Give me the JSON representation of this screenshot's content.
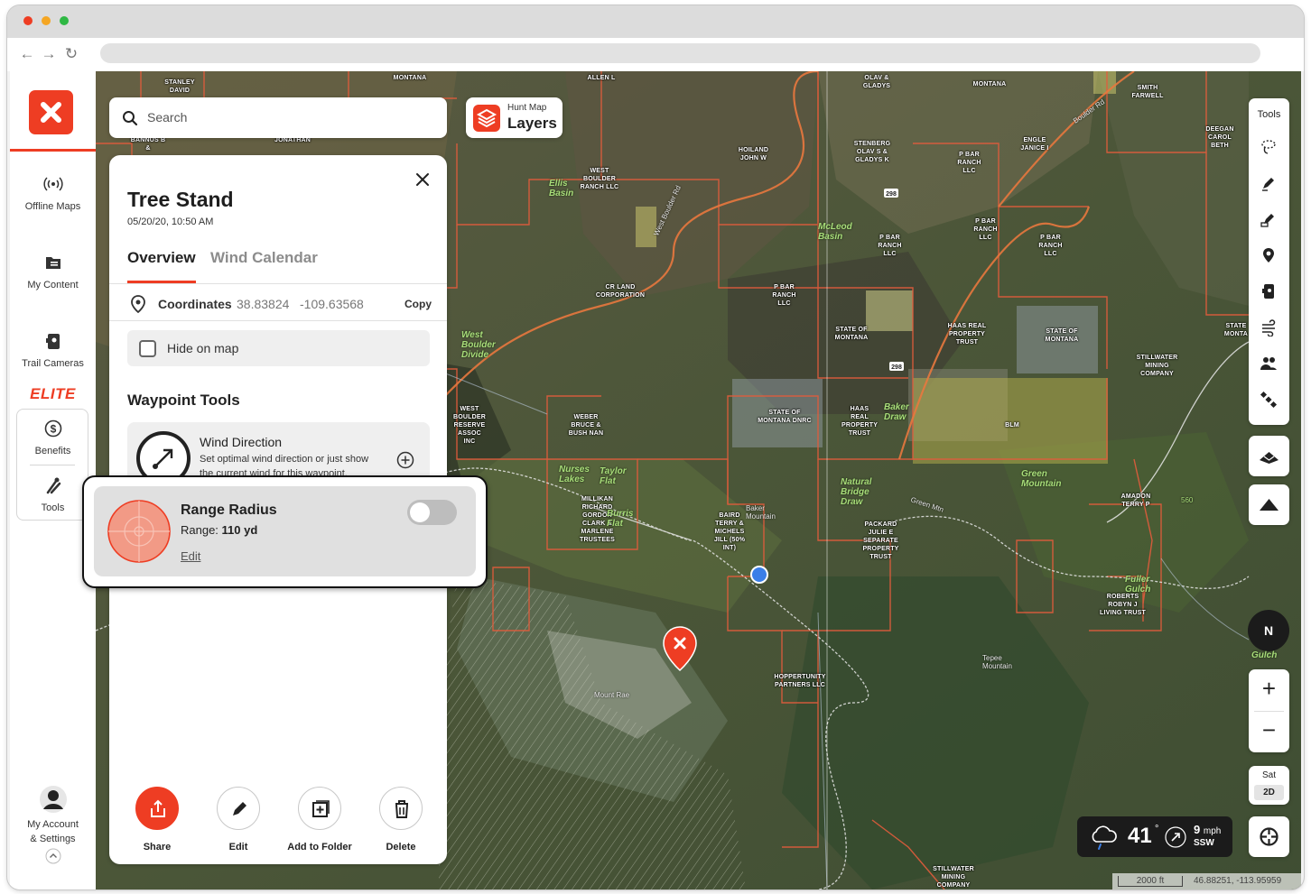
{
  "browser": {
    "dots": [
      "#ee3d23",
      "#f5a623",
      "#2fb844"
    ]
  },
  "sidebar": {
    "items": [
      {
        "label": "Offline Maps",
        "icon": "broadcast-icon"
      },
      {
        "label": "My Content",
        "icon": "folder-icon"
      },
      {
        "label": "Trail Cameras",
        "icon": "camera-icon"
      }
    ],
    "elite": "ELITE",
    "elite_items": [
      {
        "label": "Benefits",
        "icon": "dollar-icon"
      },
      {
        "label": "Tools",
        "icon": "tools-icon"
      }
    ],
    "account": {
      "line1": "My Account",
      "line2": "& Settings"
    }
  },
  "search": {
    "placeholder": "Search"
  },
  "layers": {
    "line1": "Hunt Map",
    "line2": "Layers"
  },
  "panel": {
    "title": "Tree Stand",
    "date": "05/20/20, 10:50 AM",
    "tabs": [
      "Overview",
      "Wind Calendar"
    ],
    "coordinates": {
      "label": "Coordinates",
      "lat": "38.83824",
      "lon": "-109.63568",
      "copy": "Copy"
    },
    "hide_on_map": "Hide on map",
    "waypoint_tools_title": "Waypoint Tools",
    "wind": {
      "title": "Wind Direction",
      "desc": "Set optimal wind direction or just show the current wind for this waypoint."
    },
    "range": {
      "title": "Range Radius",
      "label": "Range:",
      "value": "110 yd",
      "edit": "Edit",
      "enabled": false
    },
    "actions": [
      "Share",
      "Edit",
      "Add to Folder",
      "Delete"
    ]
  },
  "tools": {
    "title": "Tools",
    "icons": [
      "lasso-icon",
      "pencil-icon",
      "marker-icon",
      "pin-icon",
      "camera-icon",
      "wind-icon",
      "people-icon",
      "satellite-icon"
    ]
  },
  "map_controls": {
    "compass": "N",
    "zoom_in": "+",
    "zoom_out": "−",
    "sat": "Sat",
    "mode": "2D"
  },
  "weather": {
    "temp": "41",
    "deg": "°",
    "speed": "9",
    "unit": "mph",
    "dir": "SSW"
  },
  "scale": {
    "distance": "2000 ft",
    "coords": "46.88251, -113.95959"
  },
  "map_labels": {
    "owners": [
      "STANLEY DAVID",
      "MONTANA",
      "ALLEN L",
      "OLAV & GLADYS",
      "MONTANA",
      "SMITH FARWELL",
      "BANNUS B &",
      "JONATHAN",
      "HOILAND JOHN W",
      "STENBERG OLAV S & GLADYS K",
      "P BAR RANCH LLC",
      "ENGLE JANICE I",
      "DEEGAN CAROL BETH",
      "WEST BOULDER RANCH LLC",
      "P BAR RANCH LLC",
      "P BAR RANCH LLC",
      "P BAR RANCH LLC",
      "CR LAND CORPORATION",
      "P BAR RANCH LLC",
      "STATE OF MONTANA",
      "HAAS REAL PROPERTY TRUST",
      "STATE OF MONTANA",
      "STATE MONTA",
      "STILLWATER MINING COMPANY",
      "WEST BOULDER RESERVE ASSOC INC",
      "WEBER BRUCE & BUSH NAN",
      "STATE OF MONTANA DNRC",
      "HAAS REAL PROPERTY TRUST",
      "BLM",
      "AMADON TERRY P",
      "MILLIKAN RICHARD GORDON CLARK & MARLENE TRUSTEES",
      "BAIRD TERRY & MICHELS JILL (50% INT)",
      "PACKARD JULIE E SEPARATE PROPERTY TRUST",
      "ROBERTS ROBYN J LIVING TRUST",
      "HOPPERTUNITY PARTNERS LLC",
      "STILLWATER MINING COMPANY"
    ],
    "places": [
      "Ellis Basin",
      "McLeod Basin",
      "West Boulder Divide",
      "Nurses Lakes",
      "Taylor Flat",
      "Burris Flat",
      "Natural Bridge Draw",
      "Baker Draw",
      "Green Mountain",
      "Baker Mountain",
      "Tepee Mountain",
      "Mount Rae",
      "Fuller Gulch",
      "Gulch"
    ],
    "roads": [
      "West Boulder Rd",
      "Boulder Rd",
      "298",
      "298",
      "560",
      "Green Mtn"
    ]
  }
}
